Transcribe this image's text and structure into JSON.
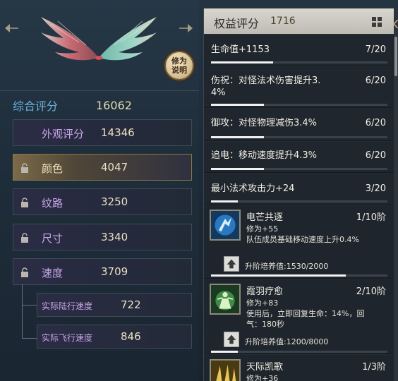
{
  "left": {
    "overall": {
      "label": "综合评分",
      "value": "16062"
    },
    "appearance": {
      "label": "外观评分",
      "value": "14346"
    },
    "stats": [
      {
        "label": "颜色",
        "value": "4047",
        "selected": true
      },
      {
        "label": "纹路",
        "value": "3250"
      },
      {
        "label": "尺寸",
        "value": "3340"
      },
      {
        "label": "速度",
        "value": "3709"
      }
    ],
    "substats": [
      {
        "label": "实际陆行速度",
        "value": "722"
      },
      {
        "label": "实际飞行速度",
        "value": "846"
      }
    ],
    "seal": {
      "line1": "修为",
      "line2": "说明"
    }
  },
  "right": {
    "header": {
      "title": "权益评分",
      "score": "1716"
    },
    "attributes": [
      {
        "label": "生命值+1153",
        "fraction": "7/20",
        "progress": 0.35
      },
      {
        "label": "伤祝：对怪法术伤害提升3.\n4%",
        "fraction": "6/20",
        "progress": 0.3
      },
      {
        "label": "御攻：对怪物理减伤3.4%",
        "fraction": "6/20",
        "progress": 0.3
      },
      {
        "label": "追电：移动速度提升4.3%",
        "fraction": "6/20",
        "progress": 0.3
      },
      {
        "label": "最小法术攻击力+24",
        "fraction": "3/20",
        "progress": 0.15
      }
    ],
    "skills": [
      {
        "name": "电芒共逐",
        "stage": "1/10阶",
        "desc_line1": "修为+55",
        "desc_line2": "队伍成员基础移动速度上升0.4%",
        "desc_line3": "",
        "upgrade": "升阶培养值:1530/2000",
        "progress": 0.765,
        "icon": "lightning-runner-icon"
      },
      {
        "name": "霞羽疗愈",
        "stage": "2/10阶",
        "desc_line1": "修为+83",
        "desc_line2": "使用后，立即回复生命：14%，回",
        "desc_line3": "气：180秒",
        "upgrade": "升阶培养值:1200/8000",
        "progress": 0.15,
        "icon": "healing-figure-icon"
      },
      {
        "name": "天际凯歌",
        "stage": "1/3阶",
        "desc_line1": "修为+36",
        "desc_line2": "",
        "desc_line3": "",
        "upgrade": "",
        "progress": 0,
        "icon": "golden-song-icon"
      }
    ]
  },
  "colors": {
    "accent_blue": "#6db0e0",
    "gold_text": "#e8d9b2",
    "purple_text": "#c9a6e8",
    "header_bg": "#d8d6cf"
  }
}
